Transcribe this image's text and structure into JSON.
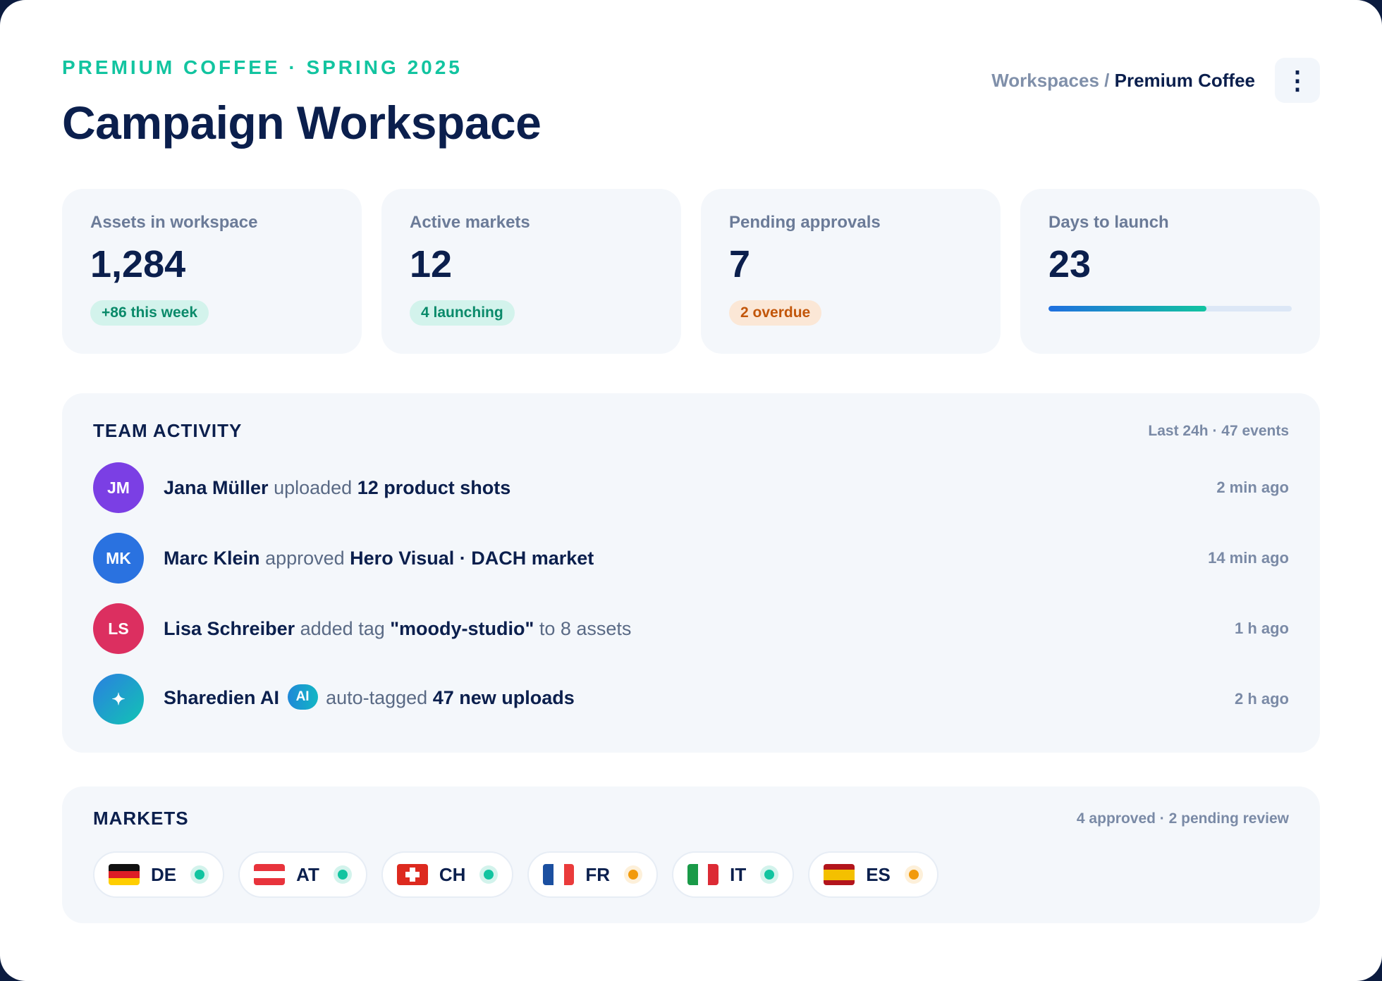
{
  "header": {
    "eyebrow": "PREMIUM COFFEE · SPRING 2025",
    "title": "Campaign Workspace",
    "breadcrumb_parent": "Workspaces",
    "breadcrumb_separator": "/",
    "breadcrumb_current": "Premium Coffee",
    "menu_icon": "⋮"
  },
  "stats": [
    {
      "label": "Assets in workspace",
      "value": "1,284",
      "chip": "+86 this week"
    },
    {
      "label": "Active markets",
      "value": "12",
      "chip": "4 launching"
    },
    {
      "label": "Pending approvals",
      "value": "7",
      "chip": "2 overdue"
    },
    {
      "label": "Days to launch",
      "value": "23",
      "progress_fraction": 0.65
    }
  ],
  "activity": {
    "title": "TEAM ACTIVITY",
    "meta": "Last 24h · 47 events",
    "items": [
      {
        "initials": "JM",
        "color": "#7b3fe4",
        "actor": "Jana Müller",
        "verb": "uploaded",
        "object": "12 product shots",
        "suffix": "",
        "time": "2 min ago"
      },
      {
        "initials": "MK",
        "color": "#2a72e0",
        "actor": "Marc Klein",
        "verb": "approved",
        "object": "Hero Visual · DACH market",
        "suffix": "",
        "time": "14 min ago"
      },
      {
        "initials": "LS",
        "color": "#dc2f60",
        "actor": "Lisa Schreiber",
        "verb": "added tag",
        "object": "\"moody-studio\"",
        "suffix": "to 8 assets",
        "time": "1 h ago"
      },
      {
        "initials": "✦",
        "color": "#1ba3c9",
        "actor": "Sharedien AI",
        "badge": "AI",
        "verb": "auto-tagged",
        "object": "47 new uploads",
        "suffix": "",
        "time": "2 h ago"
      }
    ]
  },
  "markets": {
    "title": "MARKETS",
    "meta": "4 approved · 2 pending review",
    "items": [
      {
        "code": "DE",
        "status": "approved"
      },
      {
        "code": "AT",
        "status": "approved"
      },
      {
        "code": "CH",
        "status": "approved"
      },
      {
        "code": "FR",
        "status": "pending"
      },
      {
        "code": "IT",
        "status": "approved"
      },
      {
        "code": "ES",
        "status": "pending"
      }
    ]
  },
  "colors": {
    "accent": "#12c4a0",
    "navy": "#0b1f4d",
    "approved": "#12c4a0",
    "pending": "#f29a0b",
    "overdue": "#c2560a"
  }
}
